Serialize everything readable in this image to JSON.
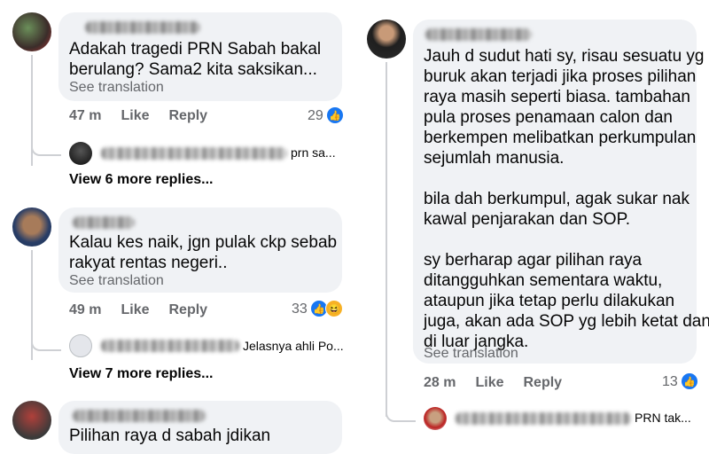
{
  "comments": [
    {
      "text_lines": [
        "Adakah tragedi PRN Sabah bakal",
        "berulang? Sama2 kita saksikan..."
      ],
      "see_translation": "See translation",
      "time": "47 m",
      "like": "Like",
      "reply": "Reply",
      "reaction_count": "29",
      "reply_preview_text": "prn sa...",
      "view_more": "View 6 more replies..."
    },
    {
      "text_lines": [
        "Kalau kes naik, jgn pulak ckp sebab",
        "rakyat rentas negeri.."
      ],
      "see_translation": "See translation",
      "time": "49 m",
      "like": "Like",
      "reply": "Reply",
      "reaction_count": "33",
      "reply_preview_text": "Jelasnya ahli Po...",
      "view_more": "View 7 more replies..."
    },
    {
      "text_lines": [
        "Pilihan raya d sabah jdikan"
      ]
    },
    {
      "text_lines": [
        "Jauh d sudut hati sy, risau sesuatu yg",
        "buruk akan terjadi jika proses pilihan",
        "raya masih seperti biasa. tambahan",
        "pula proses penamaan calon dan",
        "berkempen melibatkan perkumpulan",
        "sejumlah manusia.",
        "",
        "bila dah berkumpul, agak sukar nak",
        "kawal penjarakan dan SOP.",
        "",
        "sy berharap agar pilihan raya",
        "ditangguhkan sementara waktu,",
        "ataupun jika tetap perlu dilakukan",
        "juga, akan ada SOP yg lebih ketat dan",
        "di luar jangka."
      ],
      "see_translation": "See translation",
      "time": "28 m",
      "like": "Like",
      "reply": "Reply",
      "reaction_count": "13",
      "reply_preview_text": "PRN tak..."
    }
  ],
  "icons": {
    "like": "thumbs-up-icon",
    "haha": "laughing-face-icon"
  },
  "colors": {
    "bubble": "#f0f2f5",
    "meta": "#65676b",
    "like_blue": "#1877f2",
    "thread": "#ced0d4"
  }
}
